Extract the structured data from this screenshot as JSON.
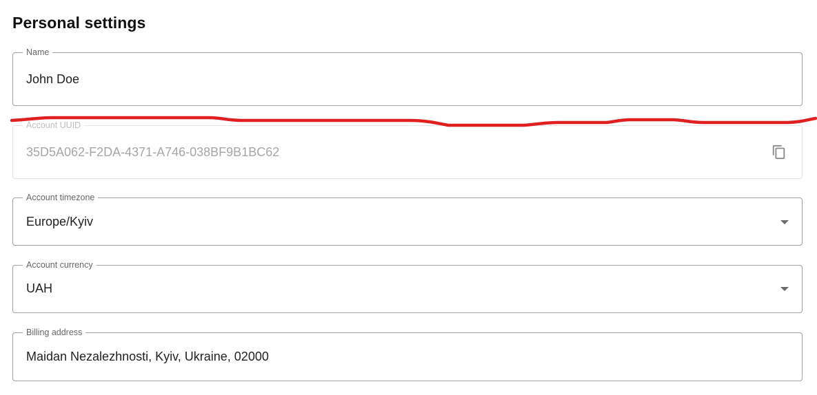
{
  "page": {
    "title": "Personal settings"
  },
  "fields": {
    "name": {
      "label": "Name",
      "value": "John Doe"
    },
    "uuid": {
      "label": "Account UUID",
      "value": "35D5A062-F2DA-4371-A746-038BF9B1BC62",
      "icon": "copy-icon",
      "disabled": true
    },
    "timezone": {
      "label": "Account timezone",
      "value": "Europe/Kyiv",
      "icon": "chevron-down-icon"
    },
    "currency": {
      "label": "Account currency",
      "value": "UAH",
      "icon": "chevron-down-icon"
    },
    "billing": {
      "label": "Billing address",
      "value": "Maidan Nezalezhnosti, Kyiv, Ukraine, 02000"
    }
  },
  "colors": {
    "border": "#9e9e9e",
    "disabled_text": "#a6a6a6",
    "annotation_line": "#e02020"
  }
}
